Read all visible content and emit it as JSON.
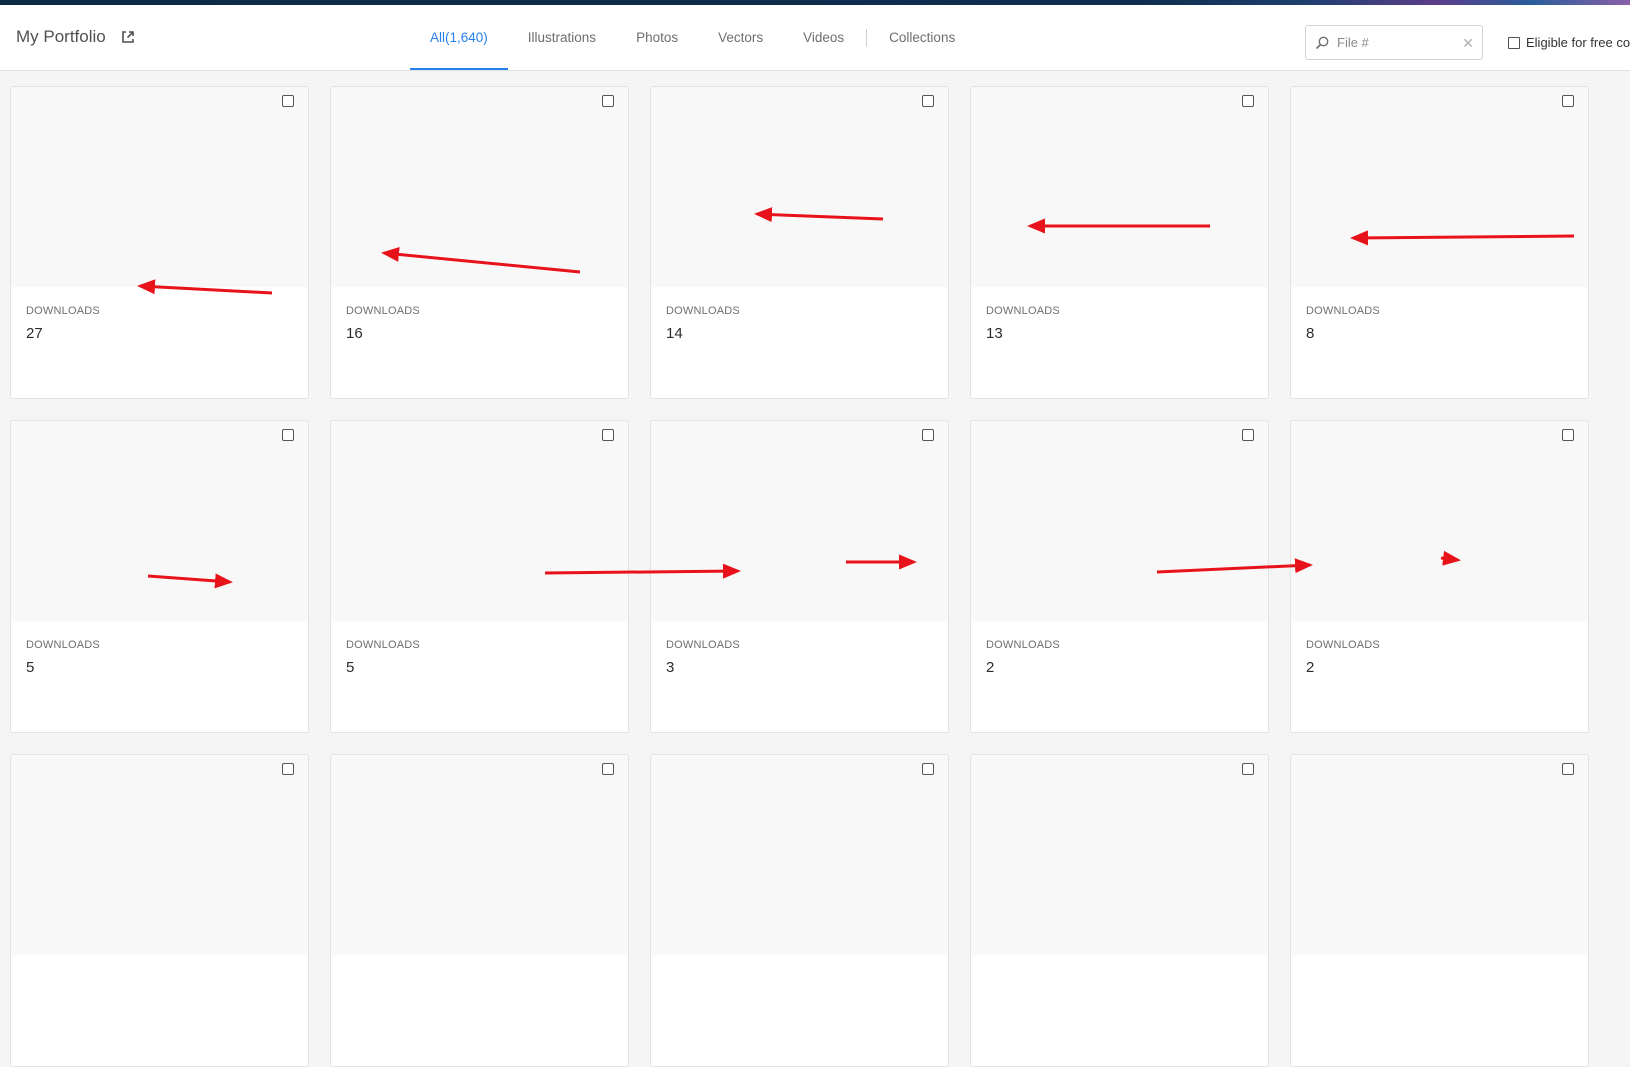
{
  "header": {
    "title": "My Portfolio",
    "tabs": [
      {
        "label": "All(1,640)",
        "active": true
      },
      {
        "label": "Illustrations",
        "active": false
      },
      {
        "label": "Photos",
        "active": false
      },
      {
        "label": "Vectors",
        "active": false
      },
      {
        "label": "Videos",
        "active": false
      },
      {
        "label": "Collections",
        "active": false
      }
    ],
    "search": {
      "placeholder": "File #",
      "value": ""
    },
    "eligible_label": "Eligible for free col"
  },
  "colors": {
    "accent": "#2680eb",
    "arrow": "#e8121a"
  },
  "cards": [
    {
      "downloads_label": "DOWNLOADS",
      "downloads": "27"
    },
    {
      "downloads_label": "DOWNLOADS",
      "downloads": "16"
    },
    {
      "downloads_label": "DOWNLOADS",
      "downloads": "14"
    },
    {
      "downloads_label": "DOWNLOADS",
      "downloads": "13"
    },
    {
      "downloads_label": "DOWNLOADS",
      "downloads": "8"
    },
    {
      "downloads_label": "DOWNLOADS",
      "downloads": "5"
    },
    {
      "downloads_label": "DOWNLOADS",
      "downloads": "5"
    },
    {
      "downloads_label": "DOWNLOADS",
      "downloads": "3"
    },
    {
      "downloads_label": "DOWNLOADS",
      "downloads": "2"
    },
    {
      "downloads_label": "DOWNLOADS",
      "downloads": "2"
    },
    {
      "downloads_label": "",
      "downloads": ""
    },
    {
      "downloads_label": "",
      "downloads": ""
    },
    {
      "downloads_label": "",
      "downloads": ""
    },
    {
      "downloads_label": "",
      "downloads": ""
    },
    {
      "downloads_label": "",
      "downloads": ""
    }
  ]
}
